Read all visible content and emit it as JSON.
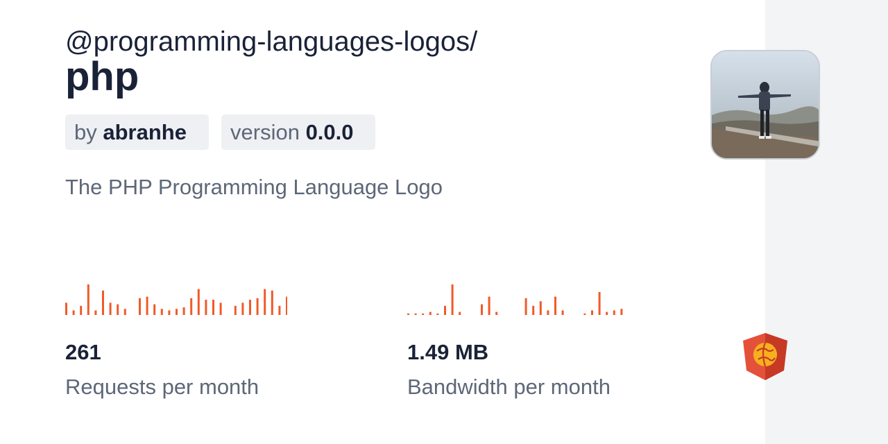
{
  "package": {
    "scope": "@programming-languages-logos/",
    "name": "php",
    "author_prefix": "by",
    "author": "abranhe",
    "version_prefix": "version",
    "version": "0.0.0",
    "description": "The PHP Programming Language Logo"
  },
  "stats": {
    "requests": {
      "value": "261",
      "label": "Requests per month"
    },
    "bandwidth": {
      "value": "1.49 MB",
      "label": "Bandwidth per month"
    }
  },
  "colors": {
    "accent": "#f05a28",
    "text": "#1a2238",
    "muted": "#5d6778",
    "pill_bg": "#eef0f3",
    "sidebar_bg": "#f3f4f6",
    "logo": "#e4513a",
    "logo_dark": "#c63a25",
    "logo_globe": "#f6b01e"
  },
  "chart_data": [
    {
      "type": "bar",
      "series": [
        {
          "values": [
            8,
            3,
            6,
            20,
            3,
            16,
            8,
            7,
            4,
            0,
            11,
            12,
            7,
            4,
            3,
            4,
            5,
            11,
            17,
            10,
            10,
            8,
            0,
            6,
            8,
            10,
            11,
            17,
            16,
            6,
            12
          ]
        }
      ]
    },
    {
      "type": "bar",
      "series": [
        {
          "values": [
            1,
            1,
            1,
            2,
            1,
            6,
            20,
            2,
            0,
            0,
            7,
            12,
            2,
            0,
            0,
            0,
            11,
            6,
            9,
            3,
            12,
            3,
            0,
            0,
            1,
            3,
            15,
            2,
            3,
            4,
            0,
            2
          ]
        }
      ]
    }
  ],
  "icons": {
    "avatar": "user-avatar-photo",
    "logo": "jsdelivr-shield-logo"
  }
}
